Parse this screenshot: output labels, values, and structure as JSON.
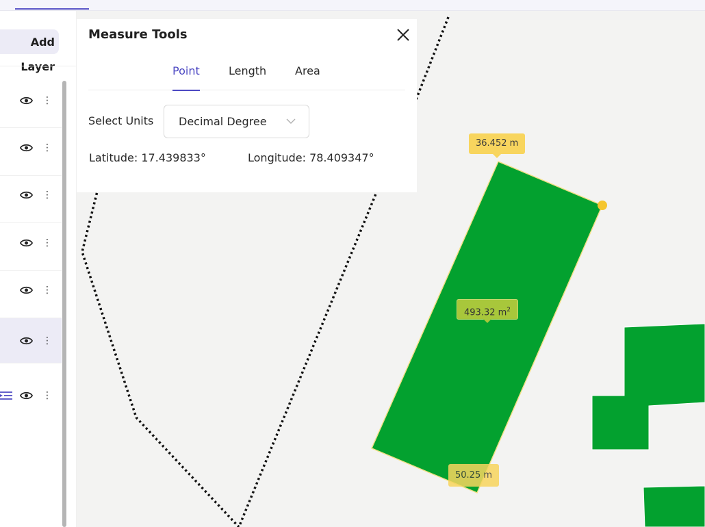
{
  "toolbar": {
    "add_layer_label": "Add Layer"
  },
  "layers": [
    {
      "visible": true,
      "selected": false
    },
    {
      "visible": true,
      "selected": false
    },
    {
      "visible": true,
      "selected": false
    },
    {
      "visible": true,
      "selected": false
    },
    {
      "visible": true,
      "selected": false
    },
    {
      "visible": true,
      "selected": true
    },
    {
      "visible": true,
      "selected": false,
      "has_legend_icon": true
    }
  ],
  "measure_tools": {
    "title": "Measure Tools",
    "tabs": [
      {
        "label": "Point",
        "active": true
      },
      {
        "label": "Length",
        "active": false
      },
      {
        "label": "Area",
        "active": false
      }
    ],
    "units_label": "Select Units",
    "units_value": "Decimal Degree",
    "latitude_label": "Latitude:",
    "latitude_value": "17.439833°",
    "longitude_label": "Longitude:",
    "longitude_value": "78.409347°"
  },
  "map": {
    "measurements": {
      "top_edge": "36.452 m",
      "area_value": "493.32 m",
      "area_unit_sup": "2",
      "bottom_edge": "50.25 m"
    }
  },
  "colors": {
    "accent": "#4d49c3",
    "parcel_fill": "#03a12f",
    "measure_tip": "#f8d55e",
    "area_tip": "#a8c73b",
    "map_bg": "#f3f3f2"
  }
}
